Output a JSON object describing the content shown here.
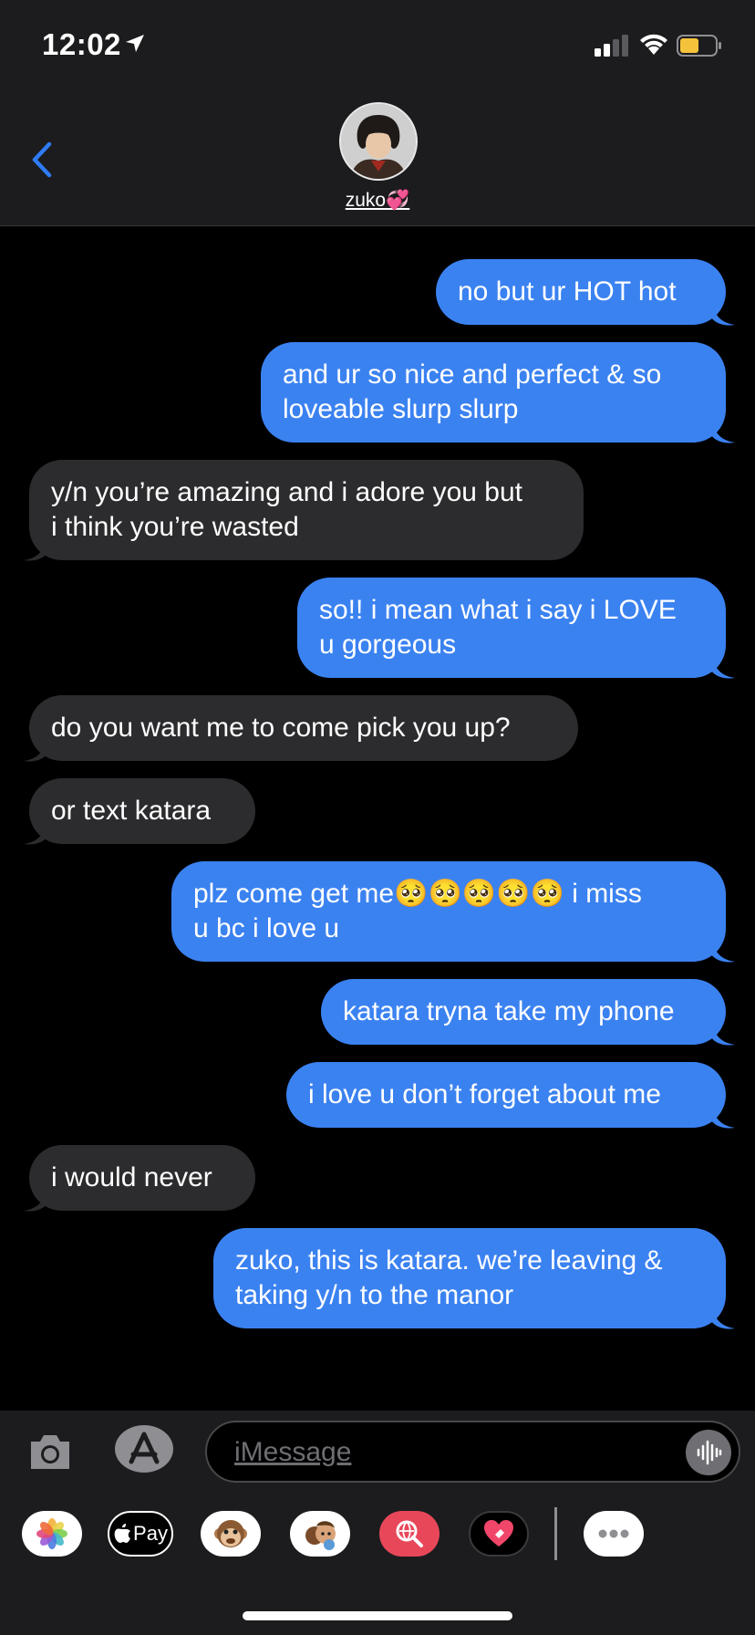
{
  "status": {
    "time": "12:02",
    "battery_color": "#f5c33b"
  },
  "header": {
    "contact_name": "zuko💞"
  },
  "messages": [
    {
      "dir": "out",
      "lines": [
        "no but ur HOT hot"
      ]
    },
    {
      "dir": "out",
      "lines": [
        "and ur so nice and perfect & so",
        "loveable slurp slurp"
      ]
    },
    {
      "dir": "in",
      "lines": [
        "y/n you’re amazing and i adore you but",
        "i think you’re wasted"
      ]
    },
    {
      "dir": "out",
      "lines": [
        "so!! i mean what i say i LOVE",
        "u gorgeous"
      ]
    },
    {
      "dir": "in",
      "lines": [
        "do you want me to come pick you up?"
      ]
    },
    {
      "dir": "in",
      "lines": [
        "or text katara"
      ]
    },
    {
      "dir": "out",
      "lines": [
        "plz come get me🥺🥺🥺🥺🥺 i miss",
        "u bc i love u"
      ]
    },
    {
      "dir": "out",
      "lines": [
        "katara tryna take my phone"
      ]
    },
    {
      "dir": "out",
      "lines": [
        "i love u don’t forget about me"
      ]
    },
    {
      "dir": "in",
      "lines": [
        "i would never"
      ]
    },
    {
      "dir": "out",
      "lines": [
        "zuko, this is katara. we’re leaving &",
        "taking y/n to the manor"
      ]
    }
  ],
  "input": {
    "placeholder": "iMessage"
  },
  "drawer": {
    "apps": [
      "photos-icon",
      "apple-pay-icon",
      "monkey-memoji-icon",
      "memoji-icon",
      "web-search-icon",
      "digital-touch-icon",
      "more-icon"
    ],
    "apple_pay_label": "Pay"
  },
  "colors": {
    "outgoing_bubble": "#3b82f1",
    "incoming_bubble": "#2c2c2e",
    "accent": "#2f7bf5"
  }
}
